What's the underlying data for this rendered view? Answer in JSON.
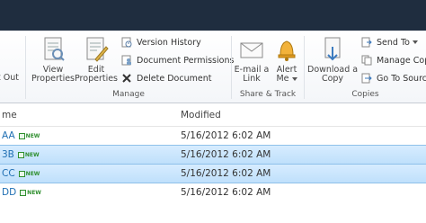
{
  "ribbon": {
    "checkout_label": "t Out",
    "view_properties": [
      "View",
      "Properties"
    ],
    "edit_properties": [
      "Edit",
      "Properties"
    ],
    "version_history": "Version History",
    "document_permissions": "Document Permissions",
    "delete_document": "Delete Document",
    "manage_group": "Manage",
    "email_link": [
      "E-mail a",
      "Link"
    ],
    "alert_me": [
      "Alert",
      "Me"
    ],
    "share_group": "Share & Track",
    "download_copy": [
      "Download a",
      "Copy"
    ],
    "send_to": "Send To",
    "manage_copies": "Manage Copi",
    "go_to_source": "Go To Sourc",
    "copies_group": "Copies"
  },
  "grid": {
    "col_name": "me",
    "col_modified": "Modified",
    "new_badge": "NEW",
    "rows": [
      {
        "name": "AA",
        "modified": "5/16/2012 6:02 AM",
        "selected": false
      },
      {
        "name": "3B",
        "modified": "5/16/2012 6:02 AM",
        "selected": true
      },
      {
        "name": "CC",
        "modified": "5/16/2012 6:02 AM",
        "selected": true
      },
      {
        "name": "DD",
        "modified": "5/16/2012 6:02 AM",
        "selected": false
      }
    ]
  }
}
